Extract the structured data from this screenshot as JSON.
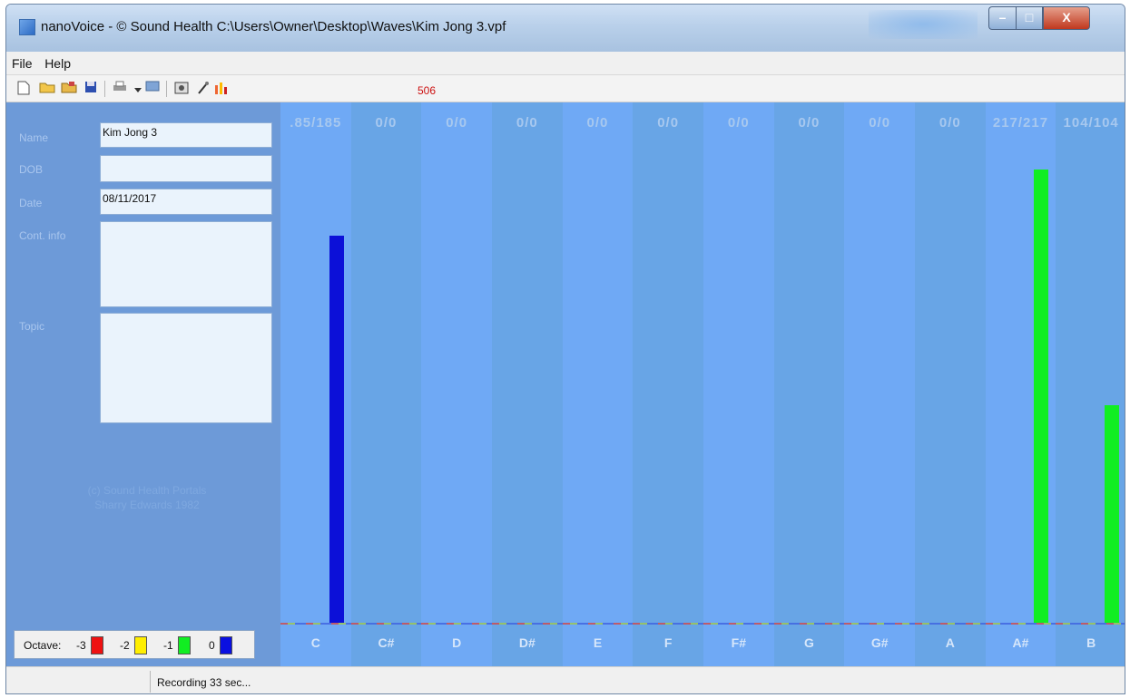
{
  "window": {
    "title": "nanoVoice - © Sound Health C:\\Users\\Owner\\Desktop\\Waves\\Kim Jong 3.vpf",
    "minimize_glyph": "–",
    "maximize_glyph": "□",
    "close_glyph": "X"
  },
  "menu": {
    "items": [
      "File",
      "Help"
    ]
  },
  "toolbar": {
    "icons": [
      "new-file-icon",
      "open-folder-icon",
      "open-recent-icon",
      "save-icon",
      "print-icon",
      "dropdown-arrow-icon",
      "monitor-icon",
      "capture-icon",
      "microphone-icon",
      "bar-chart-icon"
    ],
    "counter": "506"
  },
  "form": {
    "name_label": "Name",
    "name_value": "Kim Jong 3",
    "dob_label": "DOB",
    "dob_value": "",
    "date_label": "Date",
    "date_value": "08/11/2017",
    "contact_label": "Cont. info",
    "contact_value": "",
    "topic_label": "Topic",
    "topic_value": ""
  },
  "copyright": {
    "line1": "(c) Sound Health Portals",
    "line2": "Sharry Edwards 1982"
  },
  "octave": {
    "label": "Octave:",
    "items": [
      {
        "value": "-3",
        "color": "#ee1111"
      },
      {
        "value": "-2",
        "color": "#ffee00"
      },
      {
        "value": "-1",
        "color": "#11ee22"
      },
      {
        "value": "0",
        "color": "#0a10e0"
      }
    ]
  },
  "chart_data": {
    "type": "bar",
    "categories": [
      "C",
      "C#",
      "D",
      "D#",
      "E",
      "F",
      "F#",
      "G",
      "G#",
      "A",
      "A#",
      "B"
    ],
    "top_labels": [
      ".85/185",
      "0/0",
      "0/0",
      "0/0",
      "0/0",
      "0/0",
      "0/0",
      "0/0",
      "0/0",
      "0/0",
      "217/217",
      "104/104"
    ],
    "values": [
      185,
      0,
      0,
      0,
      0,
      0,
      0,
      0,
      0,
      0,
      217,
      104
    ],
    "bar_colors": [
      "#0c10d8",
      "#0c10d8",
      "#0c10d8",
      "#0c10d8",
      "#0c10d8",
      "#0c10d8",
      "#0c10d8",
      "#0c10d8",
      "#0c10d8",
      "#0c10d8",
      "#11ee22",
      "#11ee22"
    ],
    "ylim": [
      0,
      222
    ],
    "col_colors": [
      "#6fa9f5",
      "#68a5e6"
    ]
  },
  "status": {
    "text": "Recording 33 sec..."
  }
}
